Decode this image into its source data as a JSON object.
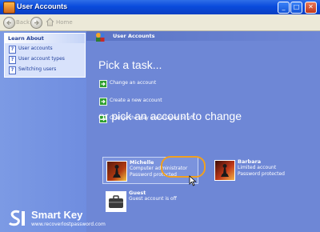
{
  "window": {
    "title": "User Accounts",
    "minimize_glyph": "_",
    "maximize_glyph": "□",
    "close_glyph": "✕"
  },
  "toolbar": {
    "back_label": "Back",
    "home_label": "Home"
  },
  "sidebar": {
    "learn_about_title": "Learn About",
    "items": [
      {
        "label": "User accounts",
        "icon": "help-icon"
      },
      {
        "label": "User account types",
        "icon": "help-icon"
      },
      {
        "label": "Switching users",
        "icon": "help-icon"
      }
    ]
  },
  "main": {
    "banner_title": "User Accounts",
    "pick_task_heading": "Pick a task...",
    "tasks": [
      {
        "label": "Change an account"
      },
      {
        "label": "Create a new account"
      },
      {
        "label": "Change the way users log on or off"
      }
    ],
    "pick_account_heading": "or pick an account to change",
    "accounts": [
      {
        "name": "Michelle",
        "line1": "Computer administrator",
        "line2": "Password protected",
        "picture": "chess-icon"
      },
      {
        "name": "Barbara",
        "line1": "Limited account",
        "line2": "Password protected",
        "picture": "chess-icon"
      },
      {
        "name": "Guest",
        "line1": "Guest account is off",
        "line2": "",
        "picture": "briefcase-icon"
      }
    ]
  },
  "watermark": {
    "title": "Smart Key",
    "url": "www.recoverlostpassword.com"
  },
  "colors": {
    "title_bar": "#0a4bdc",
    "content_bg": "#6e87d6",
    "task_arrow": "#2e9f2e",
    "highlight": "#f0a020"
  }
}
